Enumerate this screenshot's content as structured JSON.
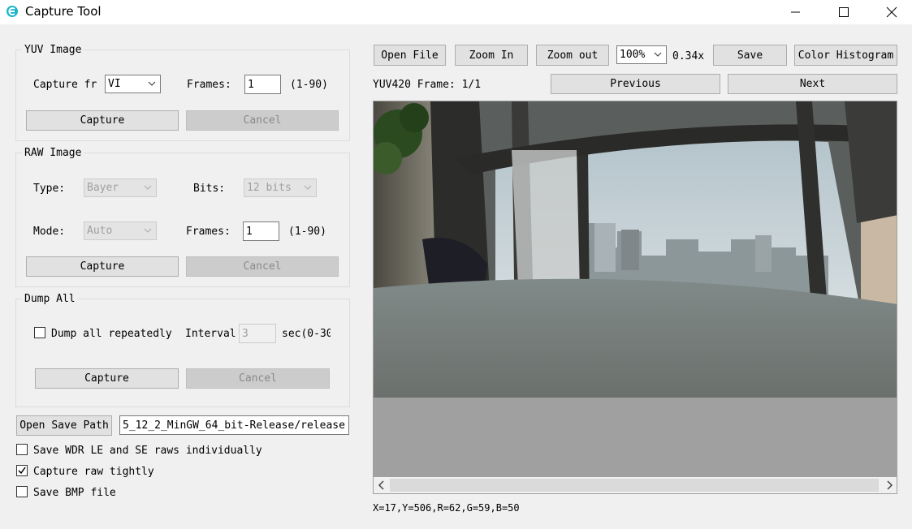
{
  "window": {
    "title": "Capture Tool"
  },
  "yuv": {
    "group_title": "YUV Image",
    "capture_from_label": "Capture fr",
    "capture_from_value": "VI",
    "frames_label": "Frames:",
    "frames_value": "1",
    "frames_range": "(1-90)",
    "capture_button": "Capture",
    "cancel_button": "Cancel"
  },
  "raw": {
    "group_title": "RAW Image",
    "type_label": "Type:",
    "type_value": "Bayer",
    "bits_label": "Bits:",
    "bits_value": "12 bits",
    "mode_label": "Mode:",
    "mode_value": "Auto",
    "frames_label": "Frames:",
    "frames_value": "1",
    "frames_range": "(1-90)",
    "capture_button": "Capture",
    "cancel_button": "Cancel"
  },
  "dump": {
    "group_title": "Dump All",
    "repeat_label": "Dump all repeatedly",
    "repeat_checked": false,
    "interval_label": "Interval",
    "interval_value": "3",
    "interval_unit": "sec(0-30",
    "capture_button": "Capture",
    "cancel_button": "Cancel"
  },
  "save": {
    "open_path_button": "Open Save Path",
    "path_value": "5_12_2_MinGW_64_bit-Release/release",
    "options": [
      {
        "label": "Save WDR LE and SE raws individually",
        "checked": false
      },
      {
        "label": "Capture raw tightly",
        "checked": true
      },
      {
        "label": "Save BMP file",
        "checked": false
      }
    ]
  },
  "viewer": {
    "open_file_button": "Open File",
    "zoom_in_button": "Zoom In",
    "zoom_out_button": "Zoom out",
    "zoom_select_value": "100%",
    "zoom_factor": "0.34x",
    "save_button": "Save",
    "histogram_button": "Color Histogram",
    "frame_info": "YUV420 Frame: 1/1",
    "previous_button": "Previous",
    "next_button": "Next",
    "pixel_info": "X=17,Y=506,R=62,G=59,B=50"
  },
  "colors": {
    "window_bg": "#f0f0f0",
    "button_bg": "#e1e1e1",
    "disabled_bg": "#cccccc",
    "viewer_bg": "#a0a0a0"
  }
}
